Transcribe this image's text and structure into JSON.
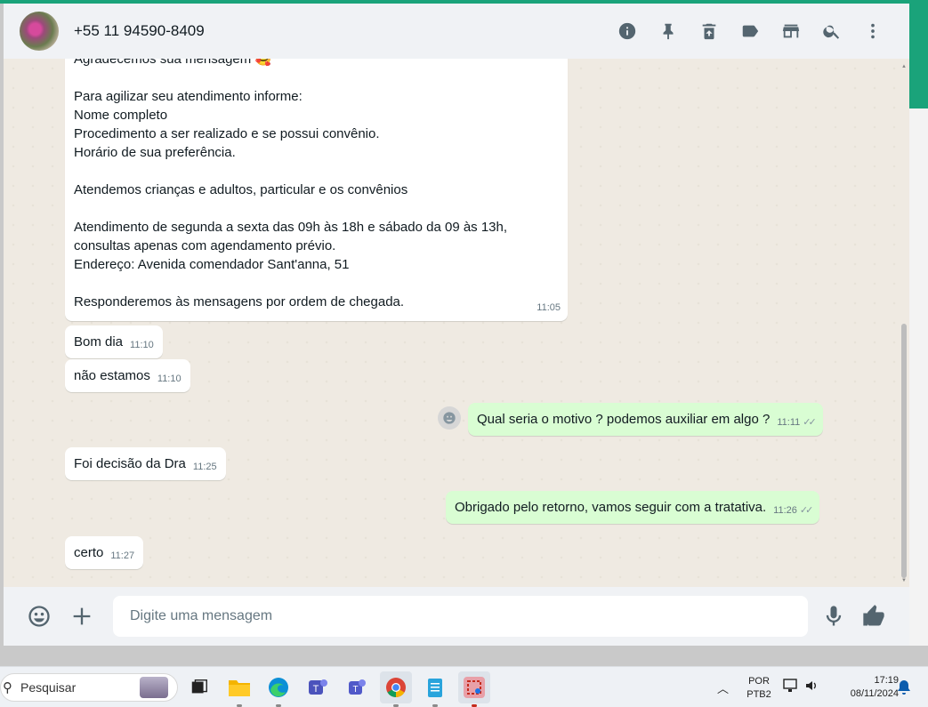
{
  "header": {
    "contact_name": "+55 11 94590-8409",
    "icons": [
      "info-icon",
      "pin-icon",
      "delete-icon",
      "label-icon",
      "store-icon",
      "search-icon",
      "menu-icon"
    ]
  },
  "messages": [
    {
      "direction": "incoming",
      "lines": [
        "Agradecemos sua mensagem 🥰",
        "",
        "Para agilizar seu atendimento informe:",
        "Nome completo",
        "Procedimento a ser realizado e se possui convênio.",
        "Horário de sua preferência.",
        "",
        "Atendemos crianças e adultos, particular e os convênios",
        "",
        "Atendimento de segunda a sexta das 09h às 18h e sábado da 09 às 13h,",
        "consultas apenas com agendamento prévio.",
        "Endereço: Avenida comendador Sant'anna, 51",
        "",
        "Responderemos às mensagens por ordem de chegada."
      ],
      "time": "11:05"
    },
    {
      "direction": "incoming",
      "text": "Bom dia",
      "time": "11:10"
    },
    {
      "direction": "incoming",
      "text": "não estamos",
      "time": "11:10"
    },
    {
      "direction": "outgoing",
      "text": "Qual seria o motivo ? podemos auxiliar em algo ?",
      "time": "11:11"
    },
    {
      "direction": "incoming",
      "text": "Foi decisão da Dra",
      "time": "11:25"
    },
    {
      "direction": "outgoing",
      "text": "Obrigado pelo retorno, vamos seguir com a tratativa.",
      "time": "11:26"
    },
    {
      "direction": "incoming",
      "text": "certo",
      "time": "11:27"
    }
  ],
  "composer": {
    "placeholder": "Digite uma mensagem"
  },
  "taskbar": {
    "search_placeholder": "Pesquisar",
    "language_line1": "POR",
    "language_line2": "PTB2",
    "time": "17:19",
    "date": "08/11/2024"
  },
  "colors": {
    "accent": "#1aa37a",
    "outgoing_bubble": "#d9fdd3",
    "incoming_bubble": "#ffffff",
    "chat_background": "#efeae2"
  }
}
